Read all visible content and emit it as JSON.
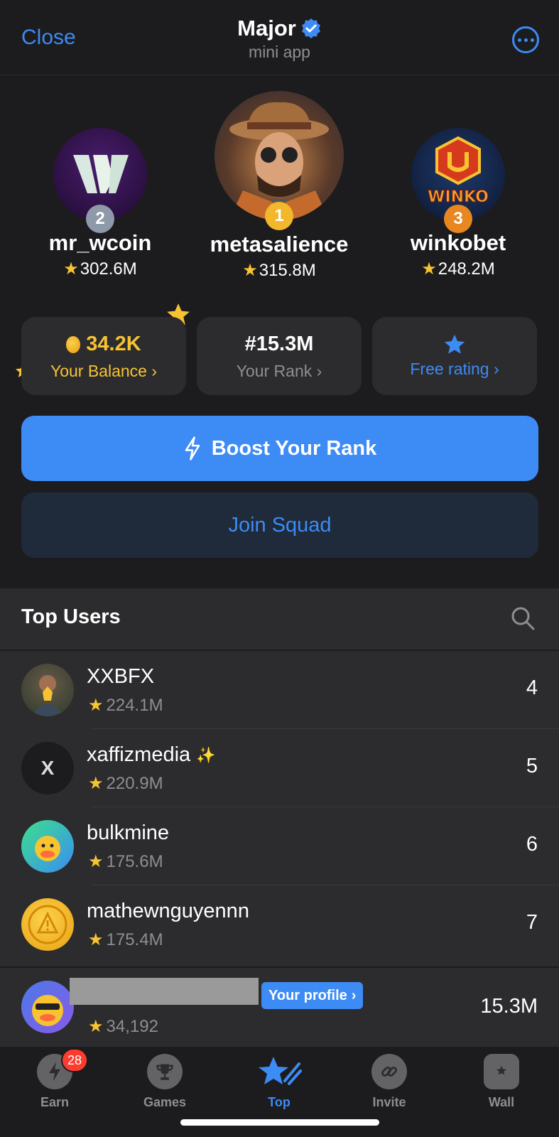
{
  "header": {
    "close_label": "Close",
    "title": "Major",
    "subtitle": "mini app"
  },
  "podium": [
    {
      "rank": "2",
      "name": "mr_wcoin",
      "score": "302.6M",
      "badge_color": "#8e9aaa"
    },
    {
      "rank": "1",
      "name": "metasalience",
      "score": "315.8M",
      "badge_color": "#f2b72a"
    },
    {
      "rank": "3",
      "name": "winkobet",
      "score": "248.2M",
      "badge_color": "#e8871f"
    }
  ],
  "stats": {
    "balance_value": "34.2K",
    "balance_label": "Your Balance",
    "rank_value": "#15.3M",
    "rank_label": "Your Rank",
    "free_label": "Free rating"
  },
  "buttons": {
    "boost_label": "Boost Your Rank",
    "squad_label": "Join Squad"
  },
  "top_users": {
    "title": "Top Users",
    "rows": [
      {
        "name": "XXBFX",
        "score": "224.1M",
        "rank": "4"
      },
      {
        "name": "xaffizmedia",
        "score": "220.9M",
        "rank": "5"
      },
      {
        "name": "bulkmine",
        "score": "175.6M",
        "rank": "6"
      },
      {
        "name": "mathewnguyennn",
        "score": "175.4M",
        "rank": "7"
      }
    ]
  },
  "profile": {
    "badge_label": "Your profile",
    "score": "34,192",
    "rank": "15.3M"
  },
  "tabs": [
    {
      "label": "Earn",
      "badge": "28"
    },
    {
      "label": "Games"
    },
    {
      "label": "Top"
    },
    {
      "label": "Invite"
    },
    {
      "label": "Wall"
    }
  ],
  "colors": {
    "accent": "#3d8bf5",
    "gold": "#f7c331",
    "background": "#1c1c1e",
    "card": "#2c2c2e"
  }
}
